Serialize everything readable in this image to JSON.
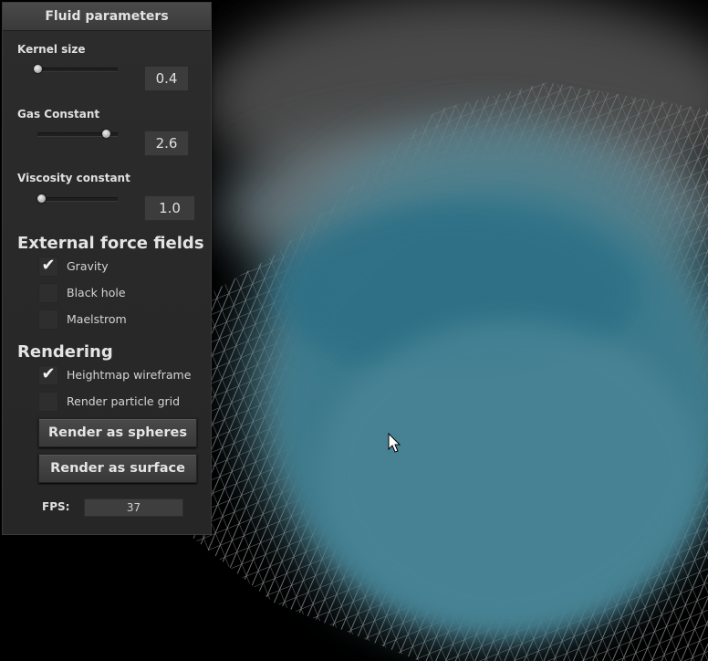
{
  "panel": {
    "title": "Fluid parameters"
  },
  "parameters": [
    {
      "label": "Kernel size",
      "value": "0.4",
      "fraction": 0.0
    },
    {
      "label": "Gas Constant",
      "value": "2.6",
      "fraction": 0.85
    },
    {
      "label": "Viscosity constant",
      "value": "1.0",
      "fraction": 0.0
    }
  ],
  "external_forces": {
    "title": "External force fields",
    "options": [
      {
        "label": "Gravity",
        "checked": true
      },
      {
        "label": "Black hole",
        "checked": false
      },
      {
        "label": "Maelstrom",
        "checked": false
      }
    ]
  },
  "rendering": {
    "title": "Rendering",
    "options": [
      {
        "label": "Heightmap wireframe",
        "checked": true
      },
      {
        "label": "Render particle grid",
        "checked": false
      }
    ],
    "buttons": {
      "spheres": "Render as spheres",
      "surface": "Render as surface"
    }
  },
  "fps": {
    "label": "FPS:",
    "value": "37"
  },
  "colors": {
    "fluid": "#3a7a8e",
    "fluid_core": "#2f6f86",
    "fog": "#8a9aa0",
    "panel": "#2b2b2b",
    "wireframe": "#c8c8c8"
  },
  "icons": {
    "check": "checkmark-icon",
    "cursor": "mouse-pointer-icon"
  }
}
